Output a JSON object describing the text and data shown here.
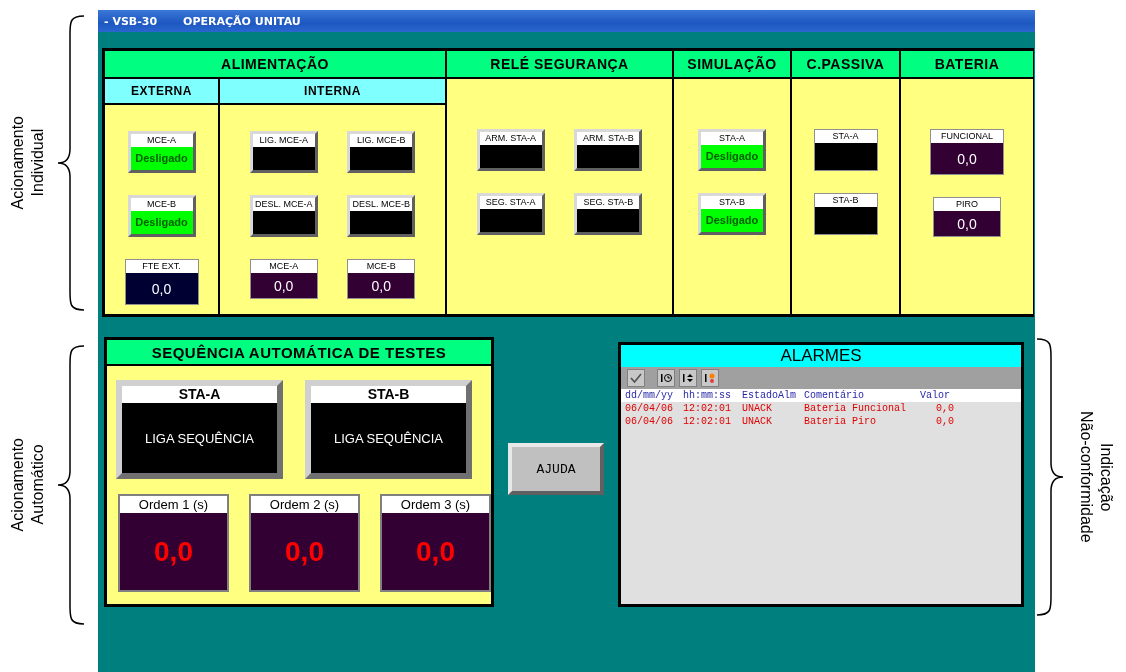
{
  "annotations": {
    "left": [
      {
        "lines": [
          "Acionamento",
          "Individual"
        ]
      },
      {
        "lines": [
          "Acionamento",
          "Automático"
        ]
      }
    ],
    "right": [
      {
        "lines": [
          "Indicação",
          "Não-conformidade"
        ]
      }
    ]
  },
  "title_bar": {
    "code": "- VSB-30",
    "title": "OPERAÇÃO UNITAU"
  },
  "individual": {
    "sections": [
      {
        "title": "ALIMENTAÇÃO",
        "groups": [
          {
            "title": "EXTERNA",
            "rows": [
              [
                {
                  "kind": "button",
                  "label": "MCE-A",
                  "status": "Desligado"
                }
              ],
              [
                {
                  "kind": "button",
                  "label": "MCE-B",
                  "status": "Desligado"
                }
              ],
              [
                {
                  "kind": "display",
                  "label": "FTE EXT.",
                  "value": "0,0",
                  "color": "#000033"
                }
              ]
            ]
          },
          {
            "title": "INTERNA",
            "rows": [
              [
                {
                  "kind": "button",
                  "label": "LIG. MCE-A"
                },
                {
                  "kind": "button",
                  "label": "LIG. MCE-B"
                }
              ],
              [
                {
                  "kind": "button",
                  "label": "DESL. MCE-A"
                },
                {
                  "kind": "button",
                  "label": "DESL. MCE-B"
                }
              ],
              [
                {
                  "kind": "display",
                  "label": "MCE-A",
                  "value": "0,0",
                  "color": "#330033"
                },
                {
                  "kind": "display",
                  "label": "MCE-B",
                  "value": "0,0",
                  "color": "#330033"
                }
              ]
            ]
          }
        ]
      },
      {
        "title": "RELÉ SEGURANÇA",
        "groups": [
          {
            "rows": [
              [
                {
                  "kind": "button",
                  "label": "ARM. STA-A"
                },
                {
                  "kind": "button",
                  "label": "ARM. STA-B"
                }
              ],
              [
                {
                  "kind": "button",
                  "label": "SEG. STA-A"
                },
                {
                  "kind": "button",
                  "label": "SEG. STA-B"
                }
              ]
            ]
          }
        ]
      },
      {
        "title": "SIMULAÇÃO",
        "groups": [
          {
            "rows": [
              [
                {
                  "kind": "button",
                  "label": "STA-A",
                  "status": "Desligado"
                }
              ],
              [
                {
                  "kind": "button",
                  "label": "STA-B",
                  "status": "Desligado"
                }
              ]
            ]
          }
        ]
      },
      {
        "title": "C.PASSIVA",
        "groups": [
          {
            "rows": [
              [
                {
                  "kind": "indicator",
                  "label": "STA-A"
                }
              ],
              [
                {
                  "kind": "indicator",
                  "label": "STA-B"
                }
              ]
            ]
          }
        ]
      },
      {
        "title": "BATERIA",
        "groups": [
          {
            "rows": [
              [
                {
                  "kind": "display",
                  "label": "FUNCIONAL",
                  "value": "0,0",
                  "color": "#330033"
                }
              ],
              [
                {
                  "kind": "display",
                  "label": "PIRO",
                  "value": "0,0",
                  "color": "#330033"
                }
              ]
            ]
          }
        ]
      }
    ]
  },
  "sequence": {
    "title": "SEQUÊNCIA AUTOMÁTICA DE TESTES",
    "starts": [
      {
        "label": "STA-A",
        "action": "LIGA SEQUÊNCIA"
      },
      {
        "label": "STA-B",
        "action": "LIGA SEQUÊNCIA"
      }
    ],
    "timers": [
      {
        "label": "Ordem 1 (s)",
        "value": "0,0"
      },
      {
        "label": "Ordem 2 (s)",
        "value": "0,0"
      },
      {
        "label": "Ordem 3 (s)",
        "value": "0,0"
      }
    ]
  },
  "help_button": "AJUDA",
  "alarms": {
    "title": "ALARMES",
    "columns": [
      "dd/mm/yy",
      "hh:mm:ss",
      "EstadoAlm",
      "Comentário",
      "Valor"
    ],
    "rows": [
      [
        "06/04/06",
        "12:02:01",
        "UNACK",
        "Bateria Funcional",
        "0,0"
      ],
      [
        "06/04/06",
        "12:02:01",
        "UNACK",
        "Bateria Piro",
        "0,0"
      ]
    ]
  }
}
